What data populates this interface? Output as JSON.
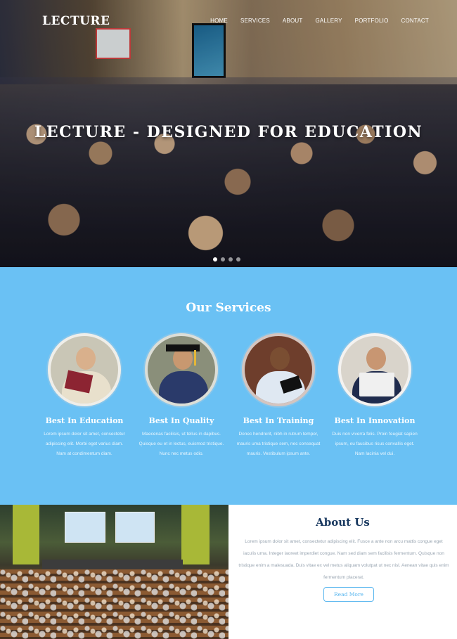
{
  "header": {
    "logo": "LECTURE",
    "nav": [
      "HOME",
      "SERVICES",
      "ABOUT",
      "GALLERY",
      "PORTFOLIO",
      "CONTACT"
    ]
  },
  "hero": {
    "title": "LECTURE - DESIGNED FOR EDUCATION",
    "slides": 4,
    "active_slide": 1
  },
  "services": {
    "title": "Our Services",
    "items": [
      {
        "title": "Best In Education",
        "text": "Lorem ipsum dolor sit amet, consectetur adipiscing elit. Morbi eget varius diam. Nam at condimentum diam."
      },
      {
        "title": "Best In Quality",
        "text": "Maecenas facilisis, ut tellus in dapibus. Quisque eu et in lectus, euismod tristique. Nunc nec metus odio."
      },
      {
        "title": "Best In Training",
        "text": "Donec hendrerit, nibh in rutrum tempor, mauris uma tristique sem, nec consequat mauris. Vestibulum ipsum ante."
      },
      {
        "title": "Best In Innovation",
        "text": "Duis non viverra felis. Proin feugiat sapien ipsum, eu faucibus risus convallis eget. Nam lacinia vel dui."
      }
    ]
  },
  "about": {
    "title": "About Us",
    "text": "Lorem ipsum dolor sit amet, consectetur adipiscing elit. Fusce a ante non arcu mattis congue eget iaculis urna. Integer laoreet imperdiet congue. Nam sed diam sem facilisis fermentum. Quisque non tristique enim a malesuada. Duis vitae ex vel metus aliquam volutpat ut nec nisl. Aenean vitae quis enim fermentum placerat.",
    "button": "Read More"
  },
  "icons": [
    "image-education",
    "image-graduate",
    "image-training",
    "image-innovation"
  ],
  "colors": {
    "services_bg": "#6ac1f4",
    "about_title": "#17375e",
    "accent": "#5bb7ef"
  }
}
